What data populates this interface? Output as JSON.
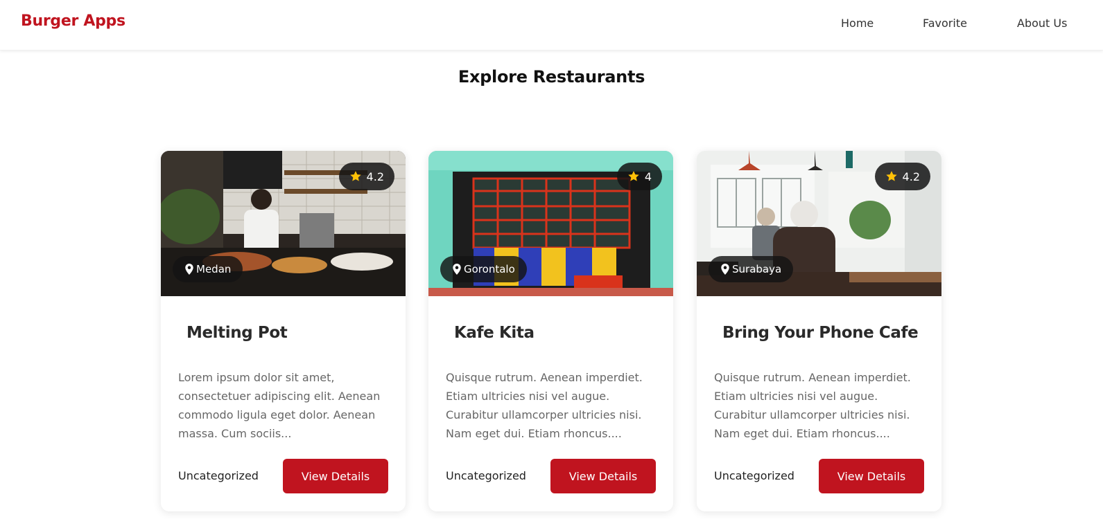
{
  "navbar": {
    "brand": "Burger Apps",
    "links": [
      {
        "label": "Home"
      },
      {
        "label": "Favorite"
      },
      {
        "label": "About Us"
      }
    ]
  },
  "page": {
    "title": "Explore Restaurants"
  },
  "colors": {
    "accent": "#c0141f",
    "star": "#ffc107"
  },
  "restaurants": [
    {
      "name": "Melting Pot",
      "rating": "4.2",
      "city": "Medan",
      "description": "Lorem ipsum dolor sit amet, consectetuer adipiscing elit. Aenean commodo ligula eget dolor. Aenean massa. Cum sociis...",
      "category": "Uncategorized",
      "button": "View Details"
    },
    {
      "name": "Kafe Kita",
      "rating": "4",
      "city": "Gorontalo",
      "description": "Quisque rutrum. Aenean imperdiet. Etiam ultricies nisi vel augue. Curabitur ullamcorper ultricies nisi. Nam eget dui. Etiam rhoncus....",
      "category": "Uncategorized",
      "button": "View Details"
    },
    {
      "name": "Bring Your Phone Cafe",
      "rating": "4.2",
      "city": "Surabaya",
      "description": "Quisque rutrum. Aenean imperdiet. Etiam ultricies nisi vel augue. Curabitur ullamcorper ultricies nisi. Nam eget dui. Etiam rhoncus....",
      "category": "Uncategorized",
      "button": "View Details"
    }
  ]
}
